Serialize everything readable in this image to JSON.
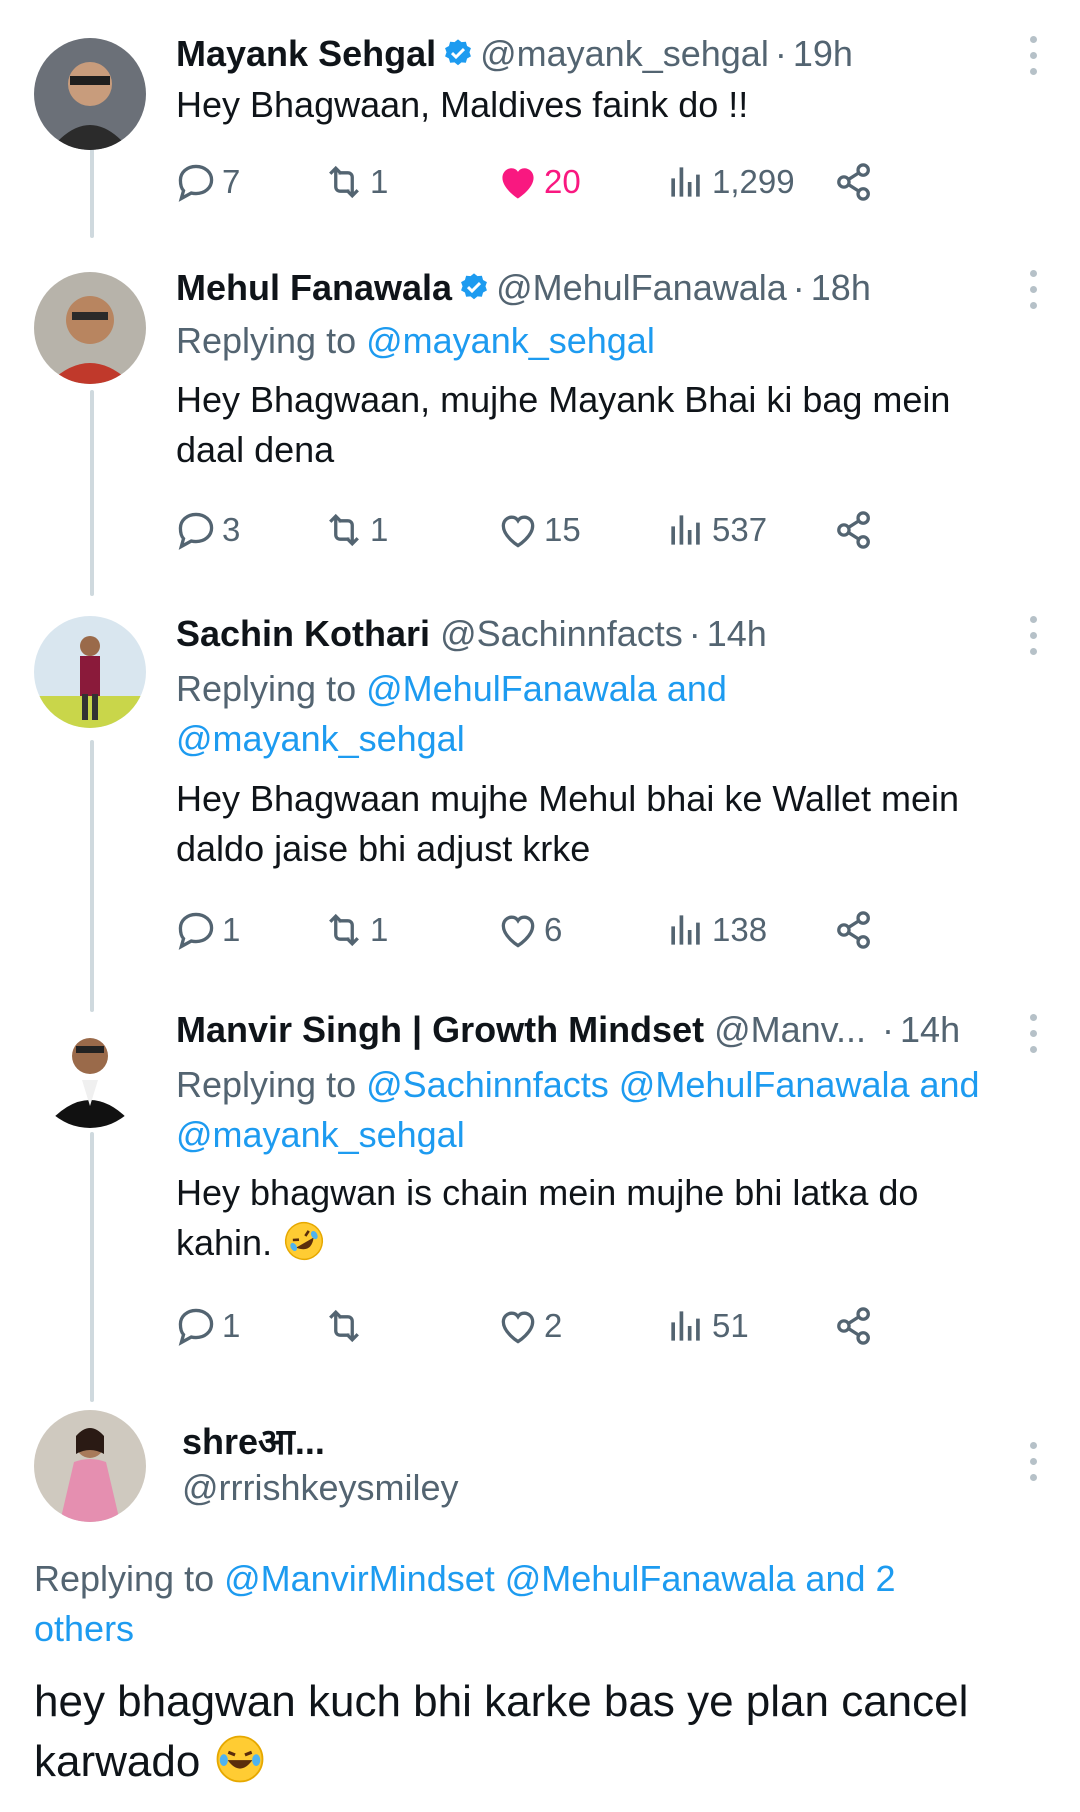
{
  "tweets": [
    {
      "name": "Mayank Sehgal",
      "verified": true,
      "handle": "@mayank_sehgal",
      "time": "19h",
      "replying_prefix": "",
      "mentions": "",
      "text": "Hey Bhagwaan, Maldives faink do !!",
      "replies": "7",
      "reposts": "1",
      "likes": "20",
      "liked": true,
      "views": "1,299"
    },
    {
      "name": "Mehul Fanawala",
      "verified": true,
      "handle": "@MehulFanawala",
      "time": "18h",
      "replying_prefix": "Replying to",
      "mentions": "@mayank_sehgal",
      "text": "Hey Bhagwaan, mujhe Mayank Bhai ki bag mein daal dena",
      "replies": "3",
      "reposts": "1",
      "likes": "15",
      "liked": false,
      "views": "537"
    },
    {
      "name": "Sachin Kothari",
      "verified": false,
      "handle": "@Sachinnfacts",
      "time": "14h",
      "replying_prefix": "Replying to",
      "mentions_line1": "@MehulFanawala and",
      "mentions_line2": "@mayank_sehgal",
      "text": "Hey Bhagwaan mujhe Mehul bhai ke Wallet mein daldo jaise bhi adjust krke",
      "replies": "1",
      "reposts": "1",
      "likes": "6",
      "liked": false,
      "views": "138"
    },
    {
      "name": "Manvir Singh | Growth Mindset",
      "verified": false,
      "handle": "@Manv...",
      "time": "14h",
      "replying_prefix": "Replying to",
      "mentions_line1": "@Sachinnfacts @MehulFanawala and",
      "mentions_line2": "@mayank_sehgal",
      "text_line1": "Hey bhagwan is chain mein mujhe bhi latka do",
      "text_line2": "kahin.",
      "emoji": "rolling-on-floor-laughing-emoji",
      "replies": "1",
      "reposts": "",
      "likes": "2",
      "liked": false,
      "views": "51"
    }
  ],
  "last_tweet": {
    "name": "shreआ...",
    "handle": "@rrrishkeysmiley",
    "replying_prefix": "Replying to",
    "mentions_line1": "@ManvirMindset @MehulFanawala and 2",
    "mentions_line2": "others",
    "text_line1": "hey bhagwan kuch bhi karke bas ye plan cancel",
    "text_line2": "karwado",
    "emoji": "face-with-tears-of-joy-emoji"
  },
  "separator_dot": "·",
  "colors": {
    "accent": "#1d9bf0",
    "like": "#f91880",
    "muted": "#536471",
    "thread_line": "#cfd9de"
  }
}
